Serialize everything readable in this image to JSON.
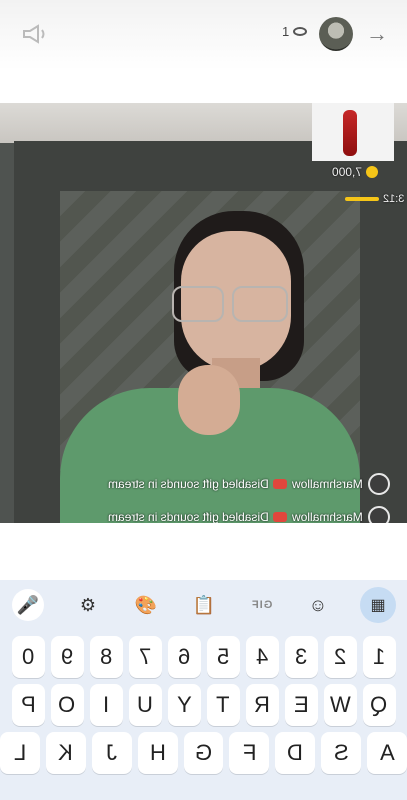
{
  "topbar": {
    "viewer_count": "1",
    "speaker_icon": "speaker-icon",
    "eye_icon": "eye-icon",
    "arrow_icon": "arrow-right-icon"
  },
  "gift": {
    "coins": "7,000",
    "timer": "3:12"
  },
  "comments": [
    {
      "user": "Marshmallow",
      "text": "Disabled gift sounds in stream"
    },
    {
      "user": "Marshmallow",
      "text": "Disabled gift sounds in stream"
    }
  ],
  "keyboard": {
    "toolbar": [
      "mic-icon",
      "settings-icon",
      "palette-icon",
      "clipboard-icon",
      "GIF",
      "sticker-icon",
      "apps-icon"
    ],
    "gif_label": "GIF",
    "row_numbers": [
      "1",
      "2",
      "3",
      "4",
      "5",
      "6",
      "7",
      "8",
      "9",
      "0"
    ],
    "row_q": [
      "Q",
      "W",
      "E",
      "R",
      "T",
      "Y",
      "U",
      "I",
      "O",
      "P"
    ],
    "row_a": [
      "A",
      "S",
      "D",
      "F",
      "G",
      "H",
      "J",
      "K",
      "L"
    ]
  }
}
